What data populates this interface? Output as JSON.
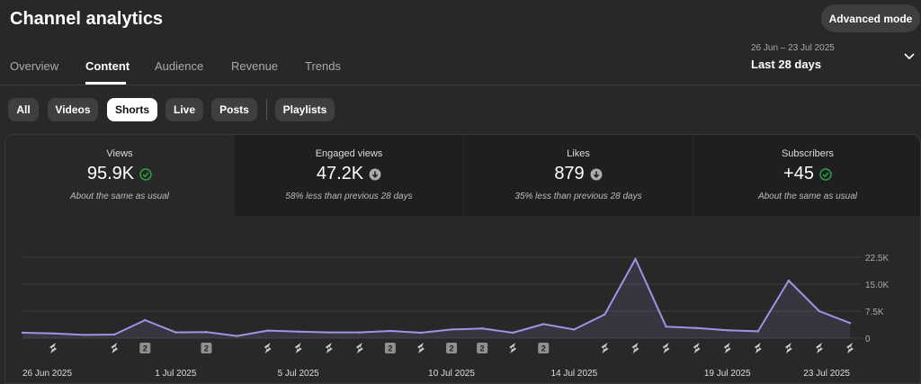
{
  "header": {
    "title": "Channel analytics",
    "advanced_mode_label": "Advanced mode"
  },
  "tabs": [
    {
      "label": "Overview",
      "active": false
    },
    {
      "label": "Content",
      "active": true
    },
    {
      "label": "Audience",
      "active": false
    },
    {
      "label": "Revenue",
      "active": false
    },
    {
      "label": "Trends",
      "active": false
    }
  ],
  "date_selector": {
    "range": "26 Jun – 23 Jul 2025",
    "period": "Last 28 days",
    "icon": "chevron-down-icon"
  },
  "chips": [
    {
      "label": "All",
      "selected": false
    },
    {
      "label": "Videos",
      "selected": false
    },
    {
      "label": "Shorts",
      "selected": true
    },
    {
      "label": "Live",
      "selected": false
    },
    {
      "label": "Posts",
      "selected": false
    },
    {
      "label": "Playlists",
      "selected": false
    }
  ],
  "metrics": [
    {
      "label": "Views",
      "value": "95.9K",
      "icon": "check-circle-icon",
      "note": "About the same as usual",
      "active": true
    },
    {
      "label": "Engaged views",
      "value": "47.2K",
      "icon": "arrow-down-circle-icon",
      "note": "58% less than previous 28 days",
      "active": false
    },
    {
      "label": "Likes",
      "value": "879",
      "icon": "arrow-down-circle-icon",
      "note": "35% less than previous 28 days",
      "active": false
    },
    {
      "label": "Subscribers",
      "value": "+45",
      "icon": "check-circle-icon",
      "note": "About the same as usual",
      "active": false
    }
  ],
  "colors": {
    "background": "#282828",
    "line": "#9b95e6",
    "success": "#2ba640",
    "neutral_icon": "#aaaaaa"
  },
  "chart_data": {
    "type": "area",
    "title": "",
    "x": [
      "26 Jun",
      "27 Jun",
      "28 Jun",
      "29 Jun",
      "30 Jun",
      "1 Jul",
      "2 Jul",
      "3 Jul",
      "4 Jul",
      "5 Jul",
      "6 Jul",
      "7 Jul",
      "8 Jul",
      "9 Jul",
      "10 Jul",
      "11 Jul",
      "12 Jul",
      "13 Jul",
      "14 Jul",
      "15 Jul",
      "16 Jul",
      "17 Jul",
      "18 Jul",
      "19 Jul",
      "20 Jul",
      "21 Jul",
      "22 Jul",
      "23 Jul"
    ],
    "series": [
      {
        "values": [
          1500,
          1300,
          900,
          1000,
          5000,
          1600,
          1700,
          600,
          2100,
          1800,
          1600,
          1600,
          2000,
          1500,
          2400,
          2700,
          1500,
          3900,
          2400,
          6600,
          22000,
          3200,
          2800,
          2200,
          1900,
          16000,
          7500,
          4200
        ]
      }
    ],
    "x_tick_labels": [
      "26 Jun 2025",
      "1 Jul 2025",
      "5 Jul 2025",
      "10 Jul 2025",
      "14 Jul 2025",
      "19 Jul 2025",
      "23 Jul 2025"
    ],
    "x_tick_indices": [
      0,
      5,
      9,
      14,
      18,
      23,
      27
    ],
    "y_ticks": [
      {
        "value": 22500,
        "label": "22.5K"
      },
      {
        "value": 15000,
        "label": "15.0K"
      },
      {
        "value": 7500,
        "label": "7.5K"
      },
      {
        "value": 0,
        "label": "0"
      }
    ],
    "ylim": [
      0,
      22500
    ],
    "y_axis_side": "right",
    "grid": true,
    "publish_markers": [
      {
        "day": 1,
        "kind": "short"
      },
      {
        "day": 3,
        "kind": "short"
      },
      {
        "day": 4,
        "kind": "count",
        "count": "2"
      },
      {
        "day": 6,
        "kind": "count",
        "count": "2"
      },
      {
        "day": 8,
        "kind": "short"
      },
      {
        "day": 9,
        "kind": "short"
      },
      {
        "day": 10,
        "kind": "short"
      },
      {
        "day": 11,
        "kind": "short"
      },
      {
        "day": 12,
        "kind": "count",
        "count": "2"
      },
      {
        "day": 13,
        "kind": "short"
      },
      {
        "day": 14,
        "kind": "count",
        "count": "2"
      },
      {
        "day": 15,
        "kind": "count",
        "count": "2"
      },
      {
        "day": 16,
        "kind": "short"
      },
      {
        "day": 17,
        "kind": "count",
        "count": "2"
      },
      {
        "day": 19,
        "kind": "short"
      },
      {
        "day": 20,
        "kind": "short"
      },
      {
        "day": 21,
        "kind": "short"
      },
      {
        "day": 22,
        "kind": "short"
      },
      {
        "day": 23,
        "kind": "short"
      },
      {
        "day": 24,
        "kind": "short"
      },
      {
        "day": 25,
        "kind": "short"
      },
      {
        "day": 26,
        "kind": "short"
      },
      {
        "day": 27,
        "kind": "short"
      }
    ]
  }
}
